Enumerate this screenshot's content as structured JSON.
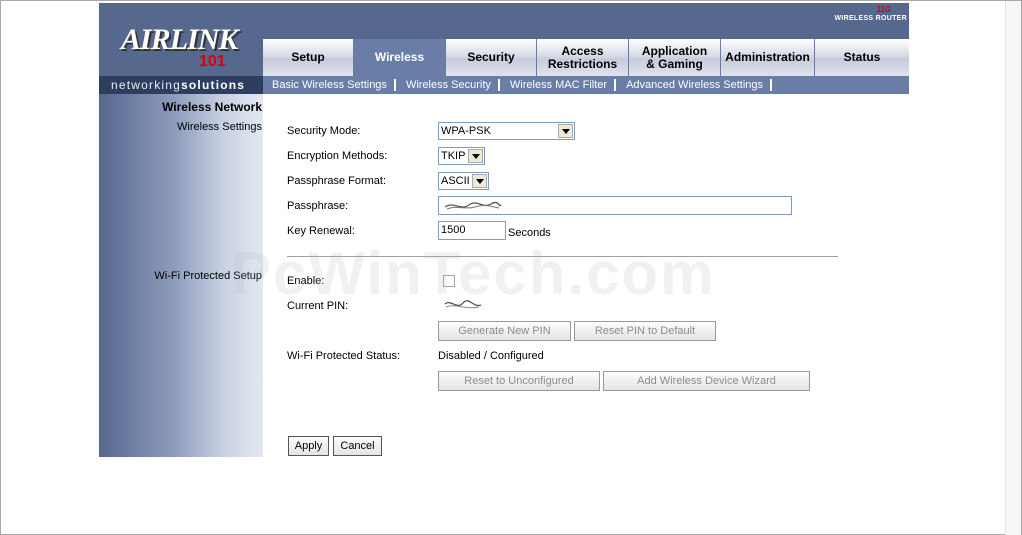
{
  "header": {
    "brand_logo": "AIRLINK",
    "brand_logo_sub": "101",
    "tagline_light": "networking",
    "tagline_bold": "solutions",
    "brand_right_top": "11G",
    "brand_right_bottom": "WIRELESS ROUTER"
  },
  "tabs": [
    {
      "label": "Setup",
      "active": false
    },
    {
      "label": "Wireless",
      "active": true
    },
    {
      "label": "Security",
      "active": false
    },
    {
      "label": "Access Restrictions",
      "active": false
    },
    {
      "label": "Application & Gaming",
      "active": false
    },
    {
      "label": "Administration",
      "active": false
    },
    {
      "label": "Status",
      "active": false
    }
  ],
  "subtabs": [
    "Basic Wireless Settings",
    "Wireless Security",
    "Wireless MAC Filter",
    "Advanced Wireless Settings"
  ],
  "left": {
    "section_title": "Wireless Network",
    "wireless_settings_label": "Wireless Settings",
    "wps_label": "Wi-Fi Protected Setup"
  },
  "form": {
    "security_mode": {
      "label": "Security Mode:",
      "value": "WPA-PSK"
    },
    "encryption": {
      "label": "Encryption Methods:",
      "value": "TKIP"
    },
    "passphrase_format": {
      "label": "Passphrase Format:",
      "value": "ASCII"
    },
    "passphrase": {
      "label": "Passphrase:",
      "value": ""
    },
    "key_renewal": {
      "label": "Key Renewal:",
      "value": "1500",
      "unit": "Seconds"
    }
  },
  "wps": {
    "enable_label": "Enable:",
    "current_pin_label": "Current PIN:",
    "generate_pin": "Generate New PIN",
    "reset_pin": "Reset PIN to Default",
    "status_label": "Wi-Fi Protected Status:",
    "status_value": "Disabled / Configured",
    "reset_unconfigured": "Reset to Unconfigured",
    "add_device_wizard": "Add Wireless Device Wizard"
  },
  "actions": {
    "apply": "Apply",
    "cancel": "Cancel"
  },
  "watermark": "PcWinTech.com",
  "colors": {
    "header": "#57688f",
    "active_tab": "#6a7da7",
    "logo_red": "#d8000f"
  }
}
